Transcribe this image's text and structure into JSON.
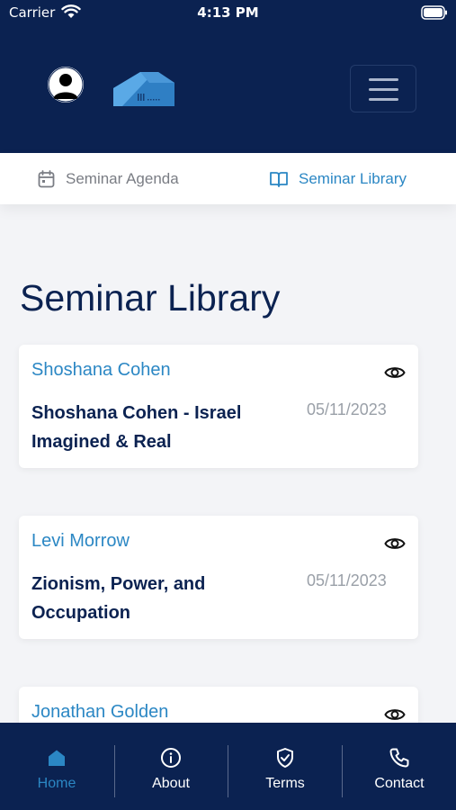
{
  "status_bar": {
    "carrier": "Carrier",
    "time": "4:13 PM"
  },
  "header": {
    "menu_icon": "hamburger-menu-icon"
  },
  "tabs": [
    {
      "label": "Seminar Agenda",
      "icon": "calendar-icon",
      "active": false
    },
    {
      "label": "Seminar Library",
      "icon": "book-icon",
      "active": true
    }
  ],
  "main": {
    "title": "Seminar Library",
    "seminars": [
      {
        "speaker": "Shoshana Cohen",
        "title": "Shoshana Cohen - Israel Imagined & Real",
        "date": "05/11/2023"
      },
      {
        "speaker": "Levi Morrow",
        "title": "Zionism, Power, and Occupation",
        "date": "05/11/2023"
      },
      {
        "speaker": "Jonathan Golden",
        "title": "",
        "date": ""
      }
    ]
  },
  "bottom_nav": [
    {
      "label": "Home",
      "icon": "home-icon",
      "active": true
    },
    {
      "label": "About",
      "icon": "info-icon",
      "active": false
    },
    {
      "label": "Terms",
      "icon": "shield-check-icon",
      "active": false
    },
    {
      "label": "Contact",
      "icon": "phone-icon",
      "active": false
    }
  ],
  "colors": {
    "navy": "#0b2251",
    "accent": "#2b87c4",
    "background": "#f3f4f7"
  }
}
